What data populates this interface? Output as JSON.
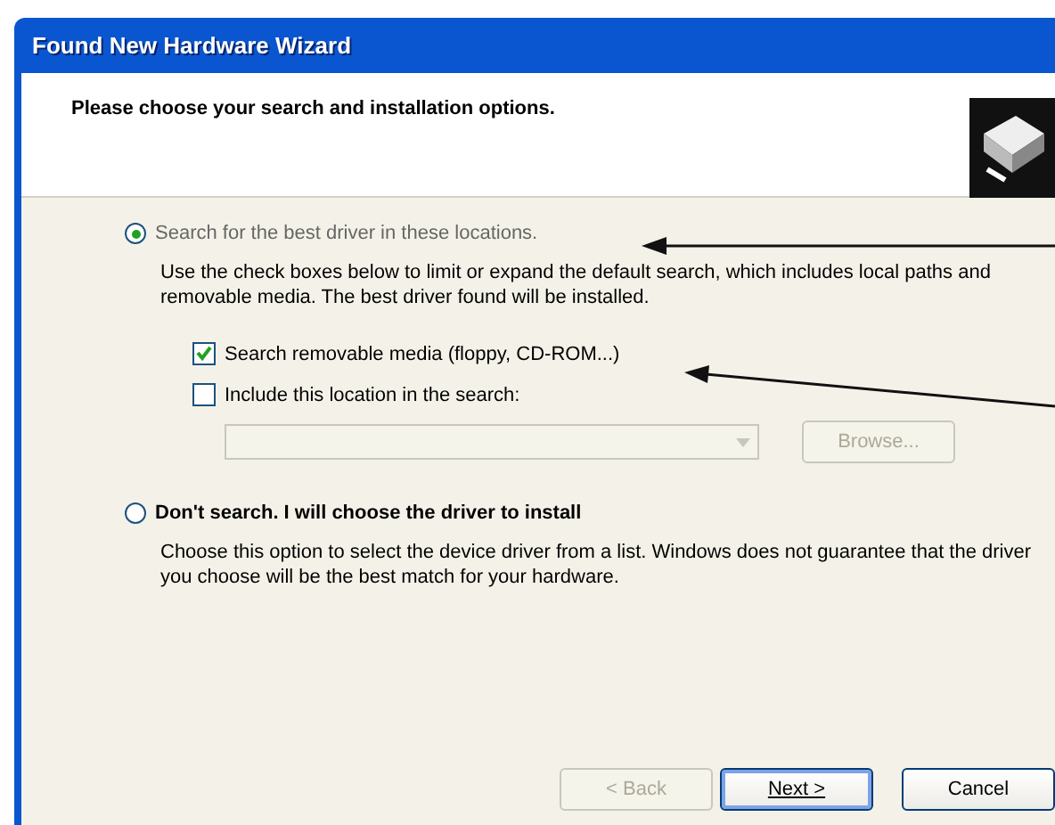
{
  "window": {
    "title": "Found New Hardware Wizard"
  },
  "header": {
    "heading": "Please choose your search and installation options."
  },
  "options": [
    {
      "label": "Search for the best driver in these locations.",
      "description": "Use the check boxes below to limit or expand the default search, which includes local paths and removable media. The best driver found will be installed.",
      "selected": true
    },
    {
      "label": "Don't search. I will choose the driver to install",
      "description": "Choose this option to select the device driver from a list. Windows does not guarantee that the driver you choose will be the best match for your hardware.",
      "selected": false
    }
  ],
  "checkboxes": [
    {
      "label": "Search removable media (floppy, CD-ROM...)",
      "checked": true
    },
    {
      "label": "Include this location in the search:",
      "checked": false
    }
  ],
  "location": {
    "disabled": true
  },
  "browse_button": {
    "label": "Browse...",
    "disabled": true
  },
  "buttons": [
    {
      "label": "< Back",
      "disabled": true,
      "default": false
    },
    {
      "label": "Next >",
      "disabled": false,
      "default": true
    },
    {
      "label": "Cancel",
      "disabled": false,
      "default": false
    }
  ]
}
